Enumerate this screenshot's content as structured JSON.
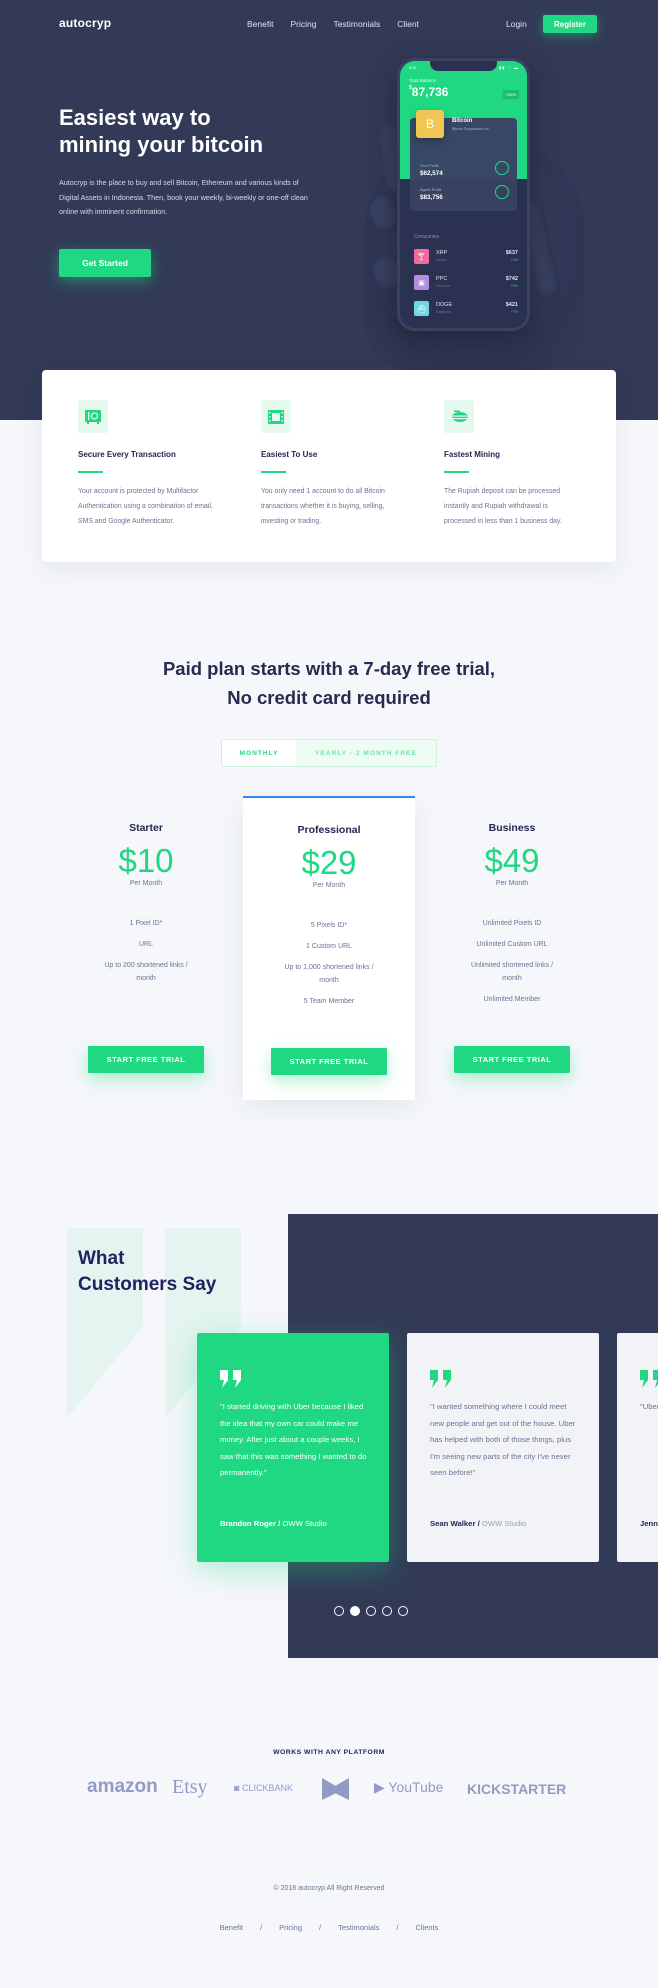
{
  "nav": {
    "logo": "autocryp",
    "links": [
      "Benefit",
      "Pricing",
      "Testimonials",
      "Client"
    ],
    "login": "Login",
    "register": "Register"
  },
  "hero": {
    "title_line1": "Easiest way to",
    "title_line2": "mining your bitcoin",
    "description": "Autocryp is the place to buy and sell Bitcoin, Ethereum and various kinds of Digital Assets in Indonesia. Then, book your weekly, bi-weekly or one-off clean online with imminent confirmation.",
    "cta": "Get Started"
  },
  "phone": {
    "time": "9:41",
    "status_icons": "signal wifi battery",
    "balance_label": "Total Balance",
    "currency": "$",
    "balance": "87,736",
    "change": "+25%",
    "coin": {
      "icon": "B",
      "name": "Bitcoin",
      "company": "Bitcoin Corporation Ltd"
    },
    "profits": [
      {
        "label": "Your Profit",
        "value": "$62,574"
      },
      {
        "label": "Agent Profit",
        "value": "$83,756"
      }
    ],
    "companies_label": "Companies",
    "companies": [
      {
        "symbol": "XRP",
        "name": "Ripple",
        "price": "$637",
        "change": "+3%",
        "color": "#f06a9c",
        "icon": "cocktail-icon"
      },
      {
        "symbol": "PPC",
        "name": "Peercoin",
        "price": "$742",
        "change": "+5%",
        "color": "#b18ee0",
        "icon": "bag-icon"
      },
      {
        "symbol": "DOGE",
        "name": "Dogecoin",
        "price": "$421",
        "change": "+7%",
        "color": "#6fd8e0",
        "icon": "boat-icon"
      }
    ]
  },
  "features": [
    {
      "icon": "safe-icon",
      "title": "Secure Every Transaction",
      "description": "Your account is protected by Multifactor Authentication using a combination of email, SMS and Google Authenticator."
    },
    {
      "icon": "film-icon",
      "title": "Easiest To Use",
      "description": "You only need 1 account to do all Bitcoin transactions whether it is buying, selling, investing or trading."
    },
    {
      "icon": "blimp-icon",
      "title": "Fastest Mining",
      "description": "The Rupiah deposit can be processed instantly and Rupiah withdrawal is processed in less than 1 business day."
    }
  ],
  "pricing": {
    "title_line1": "Paid plan starts with a 7-day free trial,",
    "title_line2": "No credit card required",
    "toggle": {
      "monthly": "MONTHLY",
      "yearly": "YEARLY - 2 MONTH FREE",
      "selected": "MONTHLY"
    },
    "plans": [
      {
        "name": "Starter",
        "price": "$10",
        "period": "Per Month",
        "features": [
          "1 Pixel ID*",
          "URL",
          "Up to 200 shortened links / month"
        ],
        "cta": "START FREE TRIAL"
      },
      {
        "name": "Professional",
        "price": "$29",
        "period": "Per Month",
        "features": [
          "5 Pixels ID*",
          "1 Custom URL",
          "Up to 1,000 shortened links / month",
          "5 Team Member"
        ],
        "cta": "START FREE TRIAL"
      },
      {
        "name": "Business",
        "price": "$49",
        "period": "Per Month",
        "features": [
          "Unlimited Pixels ID",
          "Unlimited Custom URL",
          "Unlimited shortened links / month",
          "Unlimited Member"
        ],
        "cta": "START FREE TRIAL"
      }
    ]
  },
  "testimonials": {
    "title_line1": "What",
    "title_line2": "Customers Say",
    "items": [
      {
        "text": "\"I started driving with Uber because I liked the idea that my own car could make me money. After just about a couple weeks, I saw that this was something I wanted to do permanently.\"",
        "author": "Brandon Roger /",
        "company": "OWW Studio"
      },
      {
        "text": "\"I wanted something where I could meet new people and get out of the house. Uber has helped with both of those things, plus I'm seeing new parts of the city I've never seen before!\"",
        "author": "Sean Walker /",
        "company": "OWW Studio"
      },
      {
        "text": "\"Uber creat cake I can have",
        "author": "Jenn",
        "company": ""
      }
    ],
    "pagination": {
      "total": 5,
      "active": 2
    }
  },
  "platforms": {
    "label": "WORKS WITH ANY PLATFORM",
    "logos": [
      "amazon",
      "Etsy",
      "CLICKBANK",
      "M",
      "YouTube",
      "KICKSTARTER"
    ]
  },
  "footer": {
    "copyright": "© 2018 autocryp All Right Reserved",
    "links": [
      "Benefit",
      "Pricing",
      "Testimonials",
      "Clients"
    ],
    "separator": "/"
  },
  "colors": {
    "brand_green": "#20d882",
    "navy": "#323a57",
    "heading": "#1f2450",
    "body_text": "#6b7394",
    "page_bg": "#f5f7fb",
    "accent_blue": "#2b8ef0"
  }
}
